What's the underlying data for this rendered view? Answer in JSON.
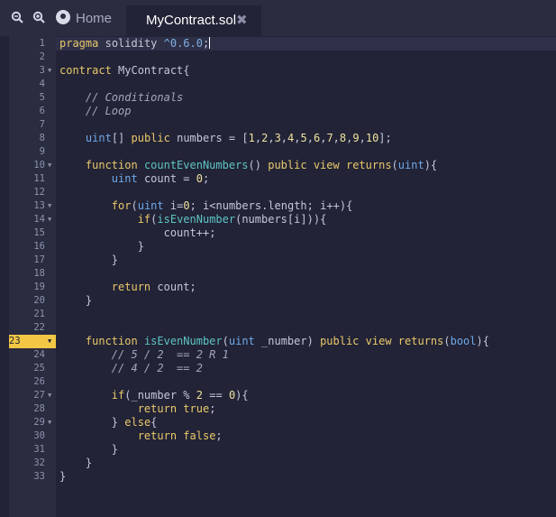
{
  "tabbar": {
    "zoom_out_icon": "zoom-out-icon",
    "zoom_in_icon": "zoom-in-icon",
    "home_label": "Home",
    "active_tab_label": "MyContract.sol",
    "close_icon": "✖"
  },
  "colors": {
    "background": "#222336",
    "gutter": "#2a2c3f",
    "active_line_marker": "#f2c744",
    "keyword": "#eac96b",
    "type": "#6fa8e8",
    "function_name": "#5ec4c4"
  },
  "editor": {
    "highlighted_line": 23,
    "fold_lines": [
      3,
      10,
      13,
      14,
      23,
      27,
      29
    ],
    "lines": [
      "pragma solidity ^0.6.0;",
      "",
      "contract MyContract{",
      "",
      "    // Conditionals",
      "    // Loop",
      "",
      "    uint[] public numbers = [1,2,3,4,5,6,7,8,9,10];",
      "",
      "    function countEvenNumbers() public view returns(uint){",
      "        uint count = 0;",
      "",
      "        for(uint i=0; i<numbers.length; i++){",
      "            if(isEvenNumber(numbers[i])){",
      "                count++;",
      "            }",
      "        }",
      "",
      "        return count;",
      "    }",
      "",
      "",
      "    function isEvenNumber(uint _number) public view returns(bool){",
      "        // 5 / 2  == 2 R 1",
      "        // 4 / 2  == 2",
      "",
      "        if(_number % 2 == 0){",
      "            return true;",
      "        } else{",
      "            return false;",
      "        }",
      "    }",
      "}"
    ]
  }
}
